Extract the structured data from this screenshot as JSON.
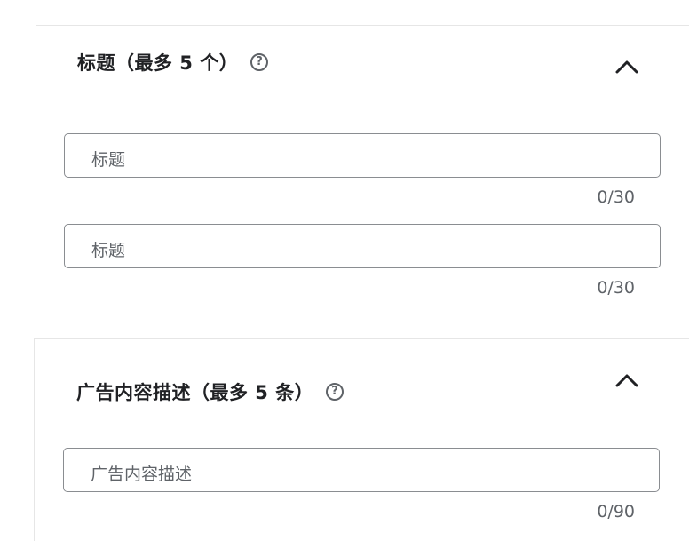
{
  "headlines": {
    "title": "标题（最多 5 个）",
    "help_icon": "help-circle-icon",
    "collapse_icon": "chevron-up-icon",
    "fields": [
      {
        "value": "",
        "placeholder": "标题",
        "counter": "0/30"
      },
      {
        "value": "",
        "placeholder": "标题",
        "counter": "0/30"
      }
    ]
  },
  "descriptions": {
    "title": "广告内容描述（最多 5 条）",
    "help_icon": "help-circle-icon",
    "collapse_icon": "chevron-up-icon",
    "fields": [
      {
        "value": "",
        "placeholder": "广告内容描述",
        "counter": "0/90"
      }
    ]
  }
}
